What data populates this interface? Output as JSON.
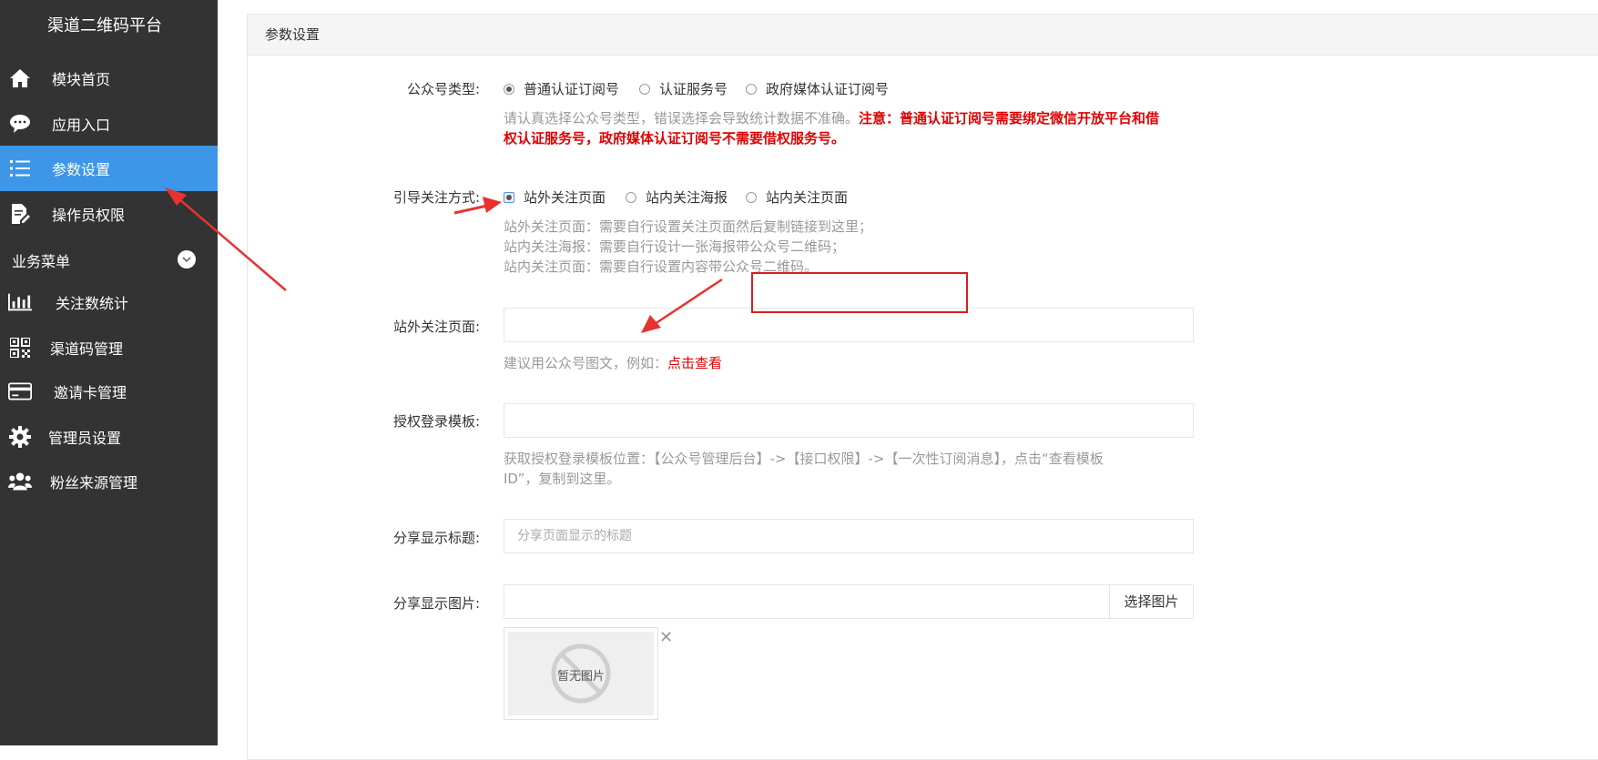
{
  "sidebar": {
    "title": "渠道二维码平台",
    "items": [
      {
        "label": "模块首页",
        "icon": "home-icon"
      },
      {
        "label": "应用入口",
        "icon": "chat-bubble-icon"
      },
      {
        "label": "参数设置",
        "icon": "list-settings-icon",
        "active": true
      },
      {
        "label": "操作员权限",
        "icon": "document-edit-icon"
      }
    ],
    "group": {
      "label": "业务菜单"
    },
    "group_items": [
      {
        "label": "关注数统计",
        "icon": "bar-chart-icon"
      },
      {
        "label": "渠道码管理",
        "icon": "qr-code-icon"
      },
      {
        "label": "邀请卡管理",
        "icon": "card-icon"
      },
      {
        "label": "管理员设置",
        "icon": "gear-icon"
      },
      {
        "label": "粉丝来源管理",
        "icon": "users-icon"
      }
    ]
  },
  "panel": {
    "title": "参数设置"
  },
  "form": {
    "account_type": {
      "label": "公众号类型:",
      "options": [
        "普通认证订阅号",
        "认证服务号",
        "政府媒体认证订阅号"
      ],
      "selected": 0,
      "help_normal": "请认真选择公众号类型，错误选择会导致统计数据不准确。",
      "help_warn_1": "注意：普通认证订阅号需要绑定微信开放平台和借",
      "help_warn_2": "权认证服务号，政府媒体认证订阅号不需要借权服务号。"
    },
    "follow_mode": {
      "label": "引导关注方式:",
      "options": [
        "站外关注页面",
        "站内关注海报",
        "站内关注页面"
      ],
      "selected": 0,
      "help": [
        "站外关注页面：需要自行设置关注页面然后复制链接到这里；",
        "站内关注海报：需要自行设计一张海报带公众号二维码；",
        "站内关注页面：需要自行设置内容带公众号二维码。"
      ]
    },
    "external_page": {
      "label": "站外关注页面:",
      "value": "",
      "help": "建议用公众号图文，例如：",
      "help_link": "点击查看"
    },
    "auth_template": {
      "label": "授权登录模板:",
      "value": "",
      "help_1": "获取授权登录模板位置：【公众号管理后台】->【接口权限】->【一次性订阅消息】，点击“查看模板",
      "help_2": "ID”，复制到这里。"
    },
    "share_title": {
      "label": "分享显示标题:",
      "placeholder": "分享页面显示的标题"
    },
    "share_image": {
      "label": "分享显示图片:",
      "value": "",
      "button": "选择图片",
      "empty_text": "暂无图片",
      "close": "✕"
    }
  },
  "colors": {
    "sidebar_bg": "#333333",
    "active_bg": "#3d96e8",
    "warning": "#e00000",
    "annotation": "#e8322f"
  }
}
